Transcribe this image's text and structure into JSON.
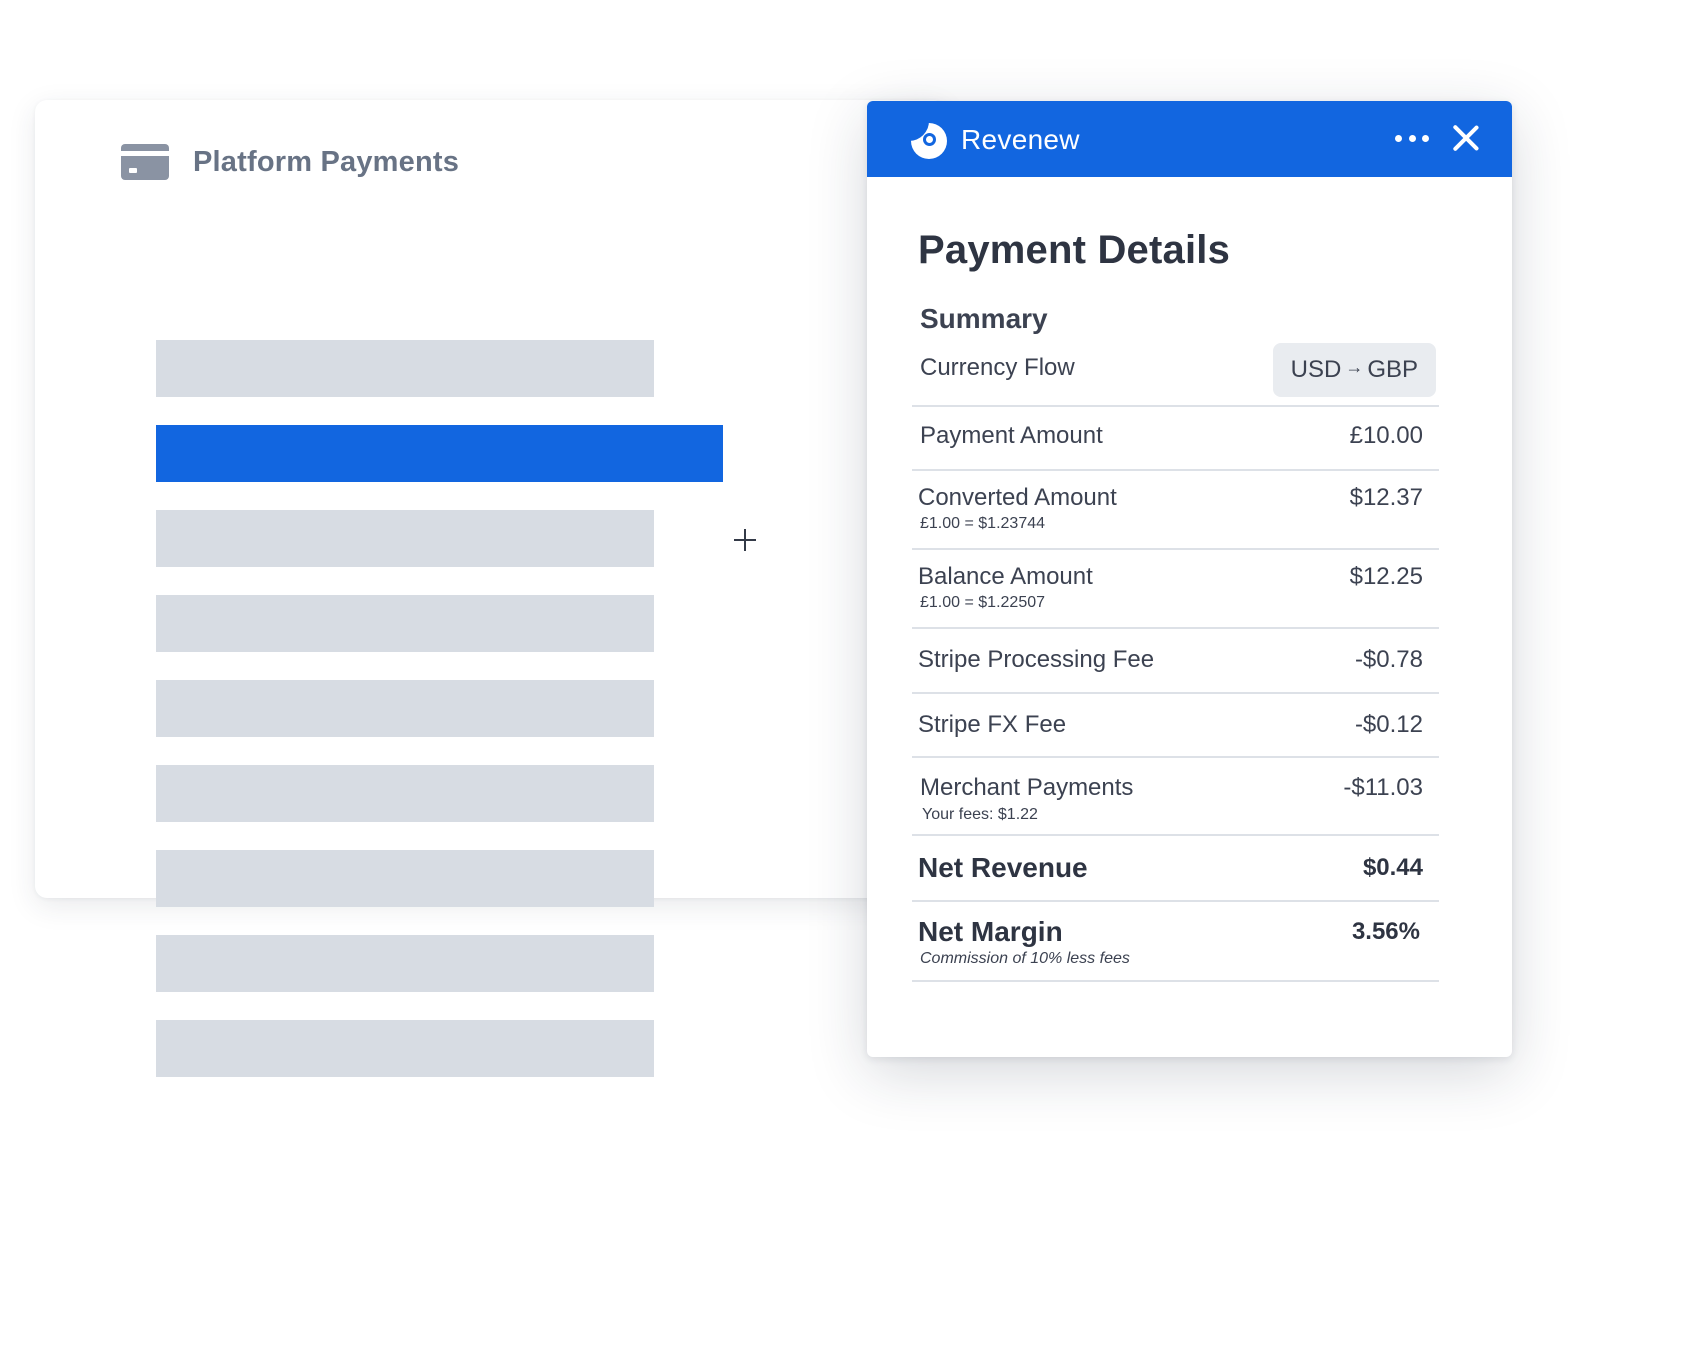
{
  "platform": {
    "title": "Platform Payments",
    "icon": "credit-card-icon",
    "list_rows": 9,
    "selected_row_index": 1
  },
  "app": {
    "name": "Revenew",
    "logo_icon": "revenew-logo-icon",
    "more_icon": "ellipsis-icon",
    "close_icon": "close-icon",
    "accent_color": "#1266e0"
  },
  "details": {
    "title": "Payment Details",
    "summary_label": "Summary",
    "currency_flow": {
      "label": "Currency Flow",
      "from": "USD",
      "arrow": "→",
      "to": "GBP"
    },
    "rows": [
      {
        "label": "Payment Amount",
        "value": "£10.00"
      },
      {
        "label": "Converted Amount",
        "sub": "£1.00 = $1.23744",
        "value": "$12.37"
      },
      {
        "label": "Balance Amount",
        "sub": "£1.00 = $1.22507",
        "value": "$12.25"
      },
      {
        "label": "Stripe Processing Fee",
        "value": "-$0.78"
      },
      {
        "label": "Stripe FX Fee",
        "value": "-$0.12"
      },
      {
        "label": "Merchant Payments",
        "sub": "Your fees: $1.22",
        "value": "-$11.03"
      },
      {
        "label": "Net Revenue",
        "value": "$0.44"
      },
      {
        "label": "Net Margin",
        "sub": "Commission of 10% less fees",
        "value": "3.56%"
      }
    ]
  }
}
